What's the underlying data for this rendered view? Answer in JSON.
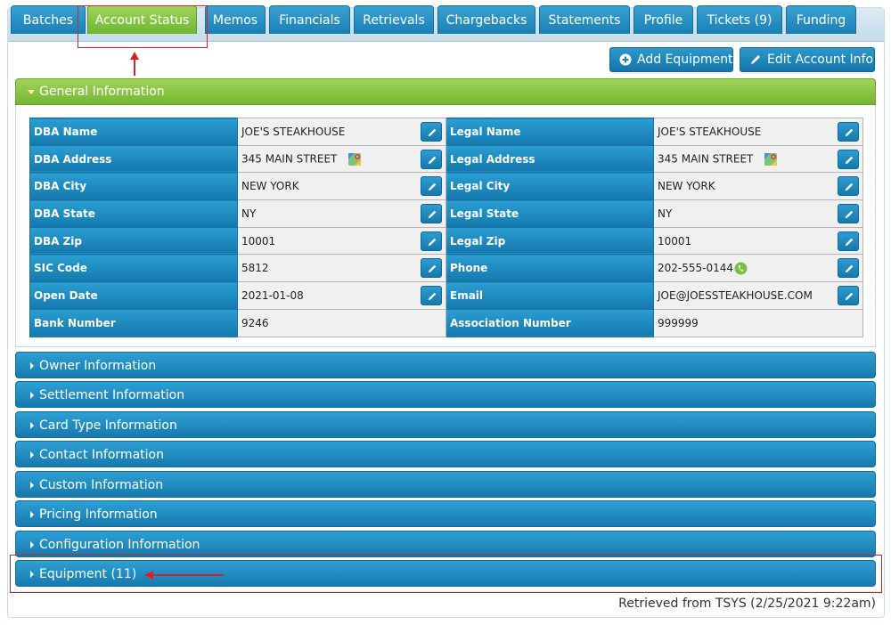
{
  "tabs": [
    {
      "label": "Batches"
    },
    {
      "label": "Account Status"
    },
    {
      "label": "Memos"
    },
    {
      "label": "Financials"
    },
    {
      "label": "Retrievals"
    },
    {
      "label": "Chargebacks"
    },
    {
      "label": "Statements"
    },
    {
      "label": "Profile"
    },
    {
      "label": "Tickets (9)"
    },
    {
      "label": "Funding"
    }
  ],
  "active_tab": "Account Status",
  "actions": {
    "add_equipment": "Add Equipment",
    "edit_account_info": "Edit Account Info"
  },
  "general_info": {
    "title": "General Information",
    "rows": [
      {
        "left_label": "DBA Name",
        "left_value": "JOE'S STEAKHOUSE",
        "right_label": "Legal Name",
        "right_value": "JOE'S STEAKHOUSE"
      },
      {
        "left_label": "DBA Address",
        "left_value": "345 MAIN STREET",
        "right_label": "Legal Address",
        "right_value": "345 MAIN STREET"
      },
      {
        "left_label": "DBA City",
        "left_value": "NEW YORK",
        "right_label": "Legal City",
        "right_value": "NEW YORK"
      },
      {
        "left_label": "DBA State",
        "left_value": "NY",
        "right_label": "Legal State",
        "right_value": "NY"
      },
      {
        "left_label": "DBA Zip",
        "left_value": "10001",
        "right_label": "Legal Zip",
        "right_value": "10001"
      },
      {
        "left_label": "SIC Code",
        "left_value": "5812",
        "right_label": "Phone",
        "right_value": "202-555-0144"
      },
      {
        "left_label": "Open Date",
        "left_value": "2021-01-08",
        "right_label": "Email",
        "right_value": "JOE@JOESSTEAKHOUSE.COM"
      },
      {
        "left_label": "Bank Number",
        "left_value": "9246",
        "right_label": "Association Number",
        "right_value": "999999"
      }
    ]
  },
  "sections": [
    {
      "label": "Owner Information"
    },
    {
      "label": "Settlement Information"
    },
    {
      "label": "Card Type Information"
    },
    {
      "label": "Contact Information"
    },
    {
      "label": "Custom Information"
    },
    {
      "label": "Pricing Information"
    },
    {
      "label": "Configuration Information"
    },
    {
      "label": "Equipment (11)"
    }
  ],
  "footer": {
    "retrieved": "Retrieved from TSYS (2/25/2021 9:22am)"
  },
  "colors": {
    "tab_blue": "#1a7fb4",
    "tab_active_green": "#6eb632",
    "annotation_red": "#d92026"
  },
  "icons": {
    "add": "plus-circle-icon",
    "edit": "pencil-icon",
    "map": "google-maps-icon",
    "phone": "phone-icon"
  }
}
